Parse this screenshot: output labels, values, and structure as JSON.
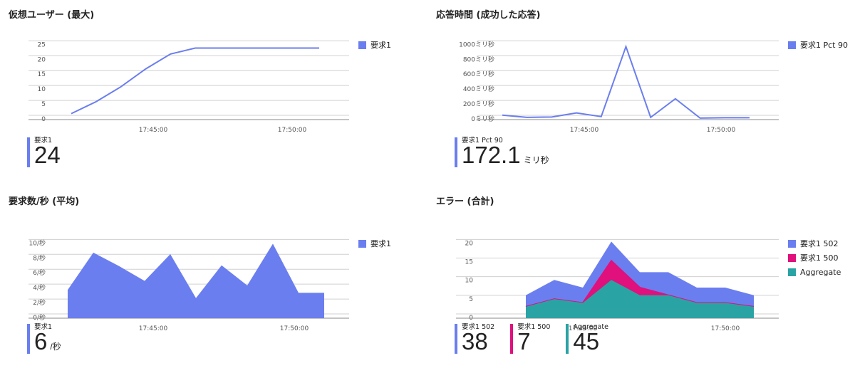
{
  "colors": {
    "series1": "#6b7eef",
    "series500": "#e0107d",
    "aggregate": "#2aa3a4",
    "grid": "#d0d0d0"
  },
  "chart_data": [
    {
      "id": "vu",
      "type": "line",
      "title": "仮想ユーザー (最大)",
      "x": [
        "17:41",
        "17:42",
        "17:43",
        "17:44",
        "17:45",
        "17:46",
        "17:47",
        "17:48",
        "17:49",
        "17:50",
        "17:51"
      ],
      "xticks": [
        "17:45:00",
        "17:50:00"
      ],
      "yticks": [
        "0",
        "5",
        "10",
        "15",
        "20",
        "25"
      ],
      "ylim": [
        0,
        27
      ],
      "series": [
        {
          "name": "要求1",
          "values": [
            2,
            6,
            11,
            17,
            22,
            24,
            24,
            24,
            24,
            24,
            24
          ]
        }
      ],
      "stats": [
        {
          "label": "要求1",
          "value": "24",
          "unit": ""
        }
      ]
    },
    {
      "id": "rt",
      "type": "line",
      "title": "応答時間 (成功した応答)",
      "x": [
        "17:41",
        "17:42",
        "17:43",
        "17:44",
        "17:45",
        "17:46",
        "17:47",
        "17:48",
        "17:49",
        "17:50",
        "17:51"
      ],
      "xticks": [
        "17:45:00",
        "17:50:00"
      ],
      "yticks": [
        "0ミリ秒",
        "200ミリ秒",
        "400ミリ秒",
        "600ミリ秒",
        "800ミリ秒",
        "1000ミリ秒"
      ],
      "ylim": [
        0,
        1080
      ],
      "series": [
        {
          "name": "要求1 Pct 90",
          "values": [
            60,
            30,
            35,
            90,
            40,
            980,
            30,
            280,
            20,
            25,
            25
          ]
        }
      ],
      "stats": [
        {
          "label": "要求1 Pct 90",
          "value": "172.1",
          "unit": "ミリ秒"
        }
      ]
    },
    {
      "id": "rps",
      "type": "area",
      "title": "要求数/秒 (平均)",
      "x": [
        "17:41",
        "17:42",
        "17:43",
        "17:44",
        "17:45",
        "17:46",
        "17:47",
        "17:48",
        "17:49",
        "17:50",
        "17:51"
      ],
      "xticks": [
        "17:45:00",
        "17:50:00"
      ],
      "yticks": [
        "0/秒",
        "2/秒",
        "4/秒",
        "6/秒",
        "8/秒",
        "10/秒"
      ],
      "ylim": [
        0,
        10.8
      ],
      "series": [
        {
          "name": "要求1",
          "values": [
            3.8,
            8.8,
            7,
            5,
            8.6,
            2.7,
            7.1,
            4.4,
            10,
            3.4,
            3.4
          ]
        }
      ],
      "stats": [
        {
          "label": "要求1",
          "value": "6",
          "unit": "/秒"
        }
      ]
    },
    {
      "id": "err",
      "type": "area",
      "title": "エラー (合計)",
      "x": [
        "17:42",
        "17:43",
        "17:44",
        "17:45",
        "17:46",
        "17:47",
        "17:48",
        "17:49",
        "17:50"
      ],
      "xticks": [
        "17:45:00",
        "17:50:00"
      ],
      "yticks": [
        "0",
        "5",
        "10",
        "15",
        "20"
      ],
      "ylim": [
        0,
        21
      ],
      "series": [
        {
          "name": "要求1 502",
          "values": [
            6,
            10,
            8,
            20,
            12,
            12,
            8,
            8,
            6
          ]
        },
        {
          "name": "要求1 500",
          "values": [
            3,
            5,
            4,
            15,
            8,
            6,
            4,
            4,
            3
          ]
        },
        {
          "name": "Aggregate",
          "values": [
            3,
            5,
            4,
            10,
            6,
            6,
            4,
            4,
            3
          ]
        }
      ],
      "stats": [
        {
          "label": "要求1 502",
          "value": "38",
          "unit": ""
        },
        {
          "label": "要求1 500",
          "value": "7",
          "unit": ""
        },
        {
          "label": "Aggregate",
          "value": "45",
          "unit": ""
        }
      ]
    }
  ]
}
